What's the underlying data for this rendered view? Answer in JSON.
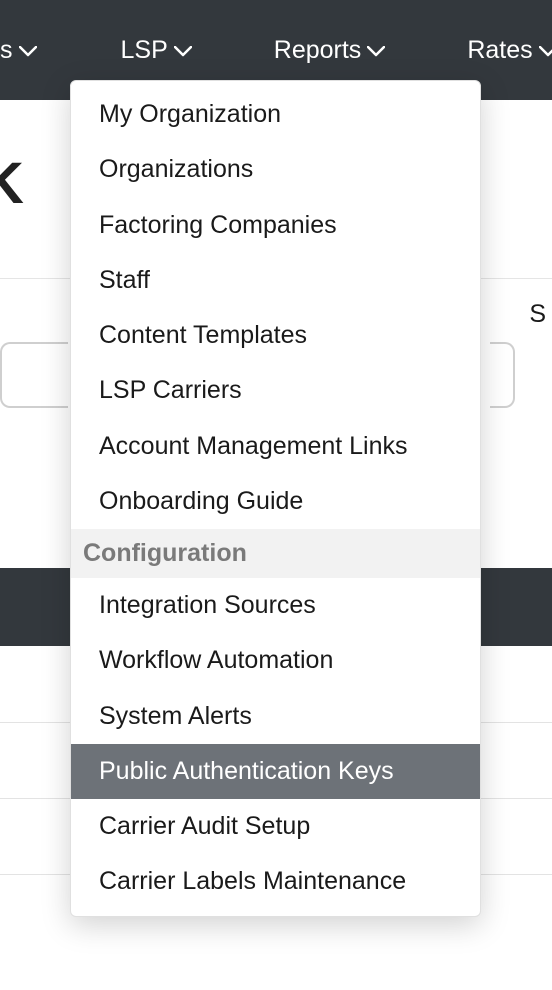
{
  "nav": {
    "partial_left_label": "s",
    "items": [
      {
        "label": "LSP"
      },
      {
        "label": "Reports"
      },
      {
        "label": "Rates"
      }
    ]
  },
  "page": {
    "heading_fragment": "  K",
    "search_label_fragment": "S"
  },
  "dropdown": {
    "items": [
      {
        "label": "My Organization",
        "type": "item"
      },
      {
        "label": "Organizations",
        "type": "item"
      },
      {
        "label": "Factoring Companies",
        "type": "item"
      },
      {
        "label": "Staff",
        "type": "item"
      },
      {
        "label": "Content Templates",
        "type": "item"
      },
      {
        "label": "LSP Carriers",
        "type": "item"
      },
      {
        "label": "Account Management Links",
        "type": "item"
      },
      {
        "label": "Onboarding Guide",
        "type": "item"
      },
      {
        "label": "Configuration",
        "type": "section"
      },
      {
        "label": "Integration Sources",
        "type": "item"
      },
      {
        "label": "Workflow Automation",
        "type": "item"
      },
      {
        "label": "System Alerts",
        "type": "item"
      },
      {
        "label": "Public Authentication Keys",
        "type": "item",
        "active": true
      },
      {
        "label": "Carrier Audit Setup",
        "type": "item"
      },
      {
        "label": "Carrier Labels Maintenance",
        "type": "item"
      }
    ]
  }
}
